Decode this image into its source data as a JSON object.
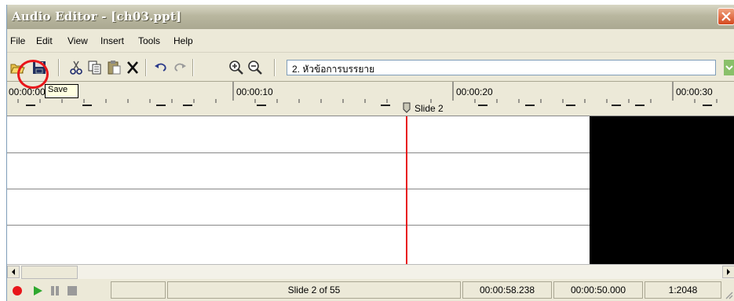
{
  "window": {
    "title": "Audio Editor - [ch03.ppt]"
  },
  "menu": [
    "File",
    "Edit",
    "View",
    "Insert",
    "Tools",
    "Help"
  ],
  "toolbar": {
    "slide_value": "2. หัวข้อการบรรยาย"
  },
  "tooltip": {
    "text": "Save"
  },
  "ruler": {
    "labels": [
      "00:00:00",
      "00:00:10",
      "00:00:20",
      "00:00:30"
    ],
    "marker_label": "Slide 2"
  },
  "status": {
    "slide_info": "Slide 2 of 55",
    "time_total": "00:00:58.238",
    "time_current": "00:00:50.000",
    "zoom": "1:2048"
  },
  "colors": {
    "accent_red": "#e8161a",
    "play_green": "#2fa82f",
    "record_red": "#e8161a"
  }
}
